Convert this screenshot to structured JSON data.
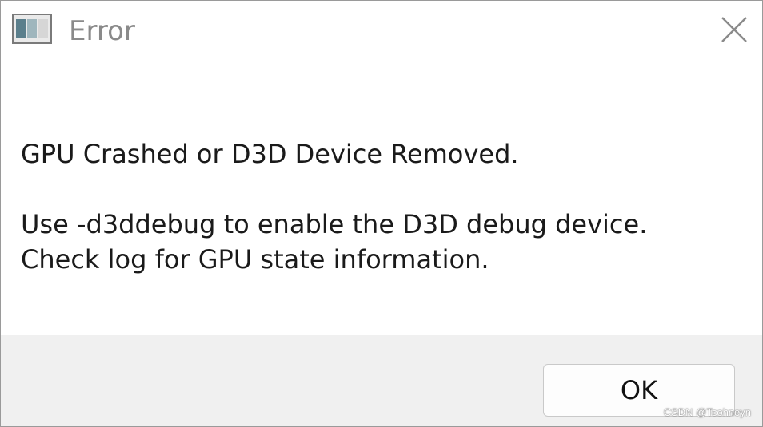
{
  "window": {
    "title": "Error",
    "app_icon": "app-window-icon",
    "close_icon": "close-icon"
  },
  "message": {
    "line1": "GPU Crashed or D3D Device Removed.",
    "line2": "Use -d3ddebug to enable the D3D debug device.",
    "line3": "Check log for GPU state information."
  },
  "buttons": {
    "ok_label": "OK"
  },
  "watermark": {
    "text": "CSDN @Tcohneyn"
  },
  "colors": {
    "footer_bg": "#f0f0f0",
    "title_text": "#8a8a8a",
    "body_text": "#1a1a1a"
  }
}
